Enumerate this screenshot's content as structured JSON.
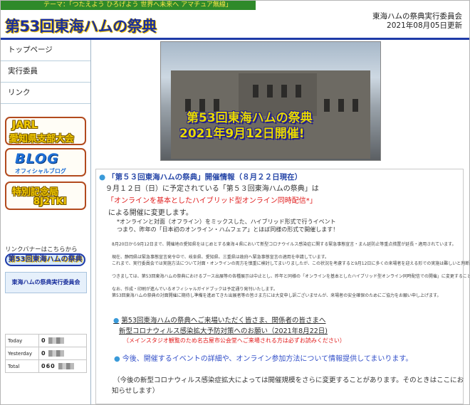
{
  "header": {
    "theme": "テーマ：「つたえよう ひろげよう 世界へ未来へ アマチュア無線」",
    "title": "第53回東海ハムの祭典",
    "org_name": "東海ハムの祭典実行委員会",
    "date": "2021年08月05日更新"
  },
  "sidebar": {
    "nav": [
      {
        "label": "トップページ"
      },
      {
        "label": "実行委員"
      },
      {
        "label": "リンク"
      }
    ],
    "banners": {
      "jarl_line1": "JARL",
      "jarl_line2": "愛知県支部大会",
      "blog_line1": "BLOG",
      "blog_line2": "オフィシャルブログ",
      "special_line1": "特別記念局",
      "special_line2": "8J2TKI"
    },
    "link_caption": "リンクバナーはこちらから",
    "link_banner_text": "第53回東海ハムの祭典",
    "org_box_text": "東海ハムの祭典実行委員会",
    "counter": [
      {
        "label": "Today",
        "value": "0"
      },
      {
        "label": "Yesterday",
        "value": "0"
      },
      {
        "label": "Total",
        "value": "060"
      }
    ]
  },
  "hero": {
    "line1": "第53回東海ハムの祭典",
    "line2": "2021年9月12日開催!"
  },
  "main": {
    "info_title": "「第５３回東海ハムの祭典」開催情報（８月２２日現在）",
    "date_line": "９月１２日（日）に予定されている「第５３回東海ハムの祭典」は",
    "red_line": "「オンラインを基本としたハイブリッド型オンライン同時配信*」",
    "hold_line": "による開催に変更します。",
    "ref_line1": "*オンラインと対面（オフライン）をミックスした、ハイブリッド形式で行うイベント",
    "ref_line2": "つまり、昨年の「日本初のオンライン・ハムフェア」とほぼ同様の形式で開催します！",
    "detail_lines": [
      "8月20日から9月12日まで、開催地の愛知県をはじめとする東海４県において新型コロナウイルス感染症に関する緊急事態宣言・まん延防止等重点措置が延長・適用されています。",
      "現在、静岡県は緊急事態宣言発令中で、岐阜県、愛知県、三重県は政府へ緊急事態宣言の適用を申請しています。",
      "これまで、実行委員会では実施方法について対面・オンラインの両方を慎重に検討してまいりましたが、この状況を考慮すると9月12日に多くの来場者を迎える形での実施は難しいと判断いたしました。",
      "つきましては、第53回東海ハムの祭典におけるブース出展等の各種展示は中止とし、昨年と同様の「オンラインを基本としたハイブリッド型オンライン同時配信での開催」に変更することにいたしました。",
      "なお、作成・印刷が進んでいるオフィシャルガイドブックは予定通り発刊いたします。",
      "第53回東海ハムの祭典の対面開催に期待し準備を進めてきた出展者等の皆さま方には大変申し訳ございませんが、来場者の安全確保のためにご協力をお願い申し上げます。"
    ],
    "notice_line1": "第53回東海ハムの祭典へご来場いただく皆さま、関係者の皆さまへ",
    "notice_line2": "新型コロナウィルス感染拡大予防対策へのお願い（2021年8月22日)",
    "notice_line3": "（メインスタジオ観覧のため名古屋市公会堂へご来場される方は必ずお読みください）",
    "update_line": "今後、開催するイベントの詳細や、オンライン参加方法について情報提供してまいります。",
    "future_line1": "（今後の新型コロナウィルス感染症拡大によっては開催規模をさらに変更することがあります。そのときはここにお",
    "future_line2": "知らせします）"
  }
}
